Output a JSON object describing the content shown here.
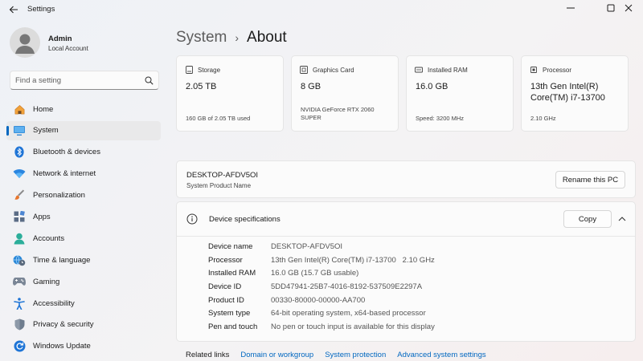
{
  "window": {
    "title": "Settings"
  },
  "user": {
    "name": "Admin",
    "account_type": "Local Account"
  },
  "search": {
    "placeholder": "Find a setting"
  },
  "sidebar": {
    "items": [
      {
        "label": "Home",
        "icon": "home-icon"
      },
      {
        "label": "System",
        "icon": "system-icon",
        "active": true
      },
      {
        "label": "Bluetooth & devices",
        "icon": "bluetooth-icon"
      },
      {
        "label": "Network & internet",
        "icon": "wifi-icon"
      },
      {
        "label": "Personalization",
        "icon": "brush-icon"
      },
      {
        "label": "Apps",
        "icon": "apps-icon"
      },
      {
        "label": "Accounts",
        "icon": "accounts-icon"
      },
      {
        "label": "Time & language",
        "icon": "globe-clock-icon"
      },
      {
        "label": "Gaming",
        "icon": "gamepad-icon"
      },
      {
        "label": "Accessibility",
        "icon": "accessibility-icon"
      },
      {
        "label": "Privacy & security",
        "icon": "shield-icon"
      },
      {
        "label": "Windows Update",
        "icon": "update-icon"
      }
    ]
  },
  "breadcrumb": {
    "parent": "System",
    "separator": "›",
    "current": "About"
  },
  "cards": {
    "storage": {
      "title": "Storage",
      "value": "2.05 TB",
      "sub": "160 GB of 2.05 TB used"
    },
    "graphics": {
      "title": "Graphics Card",
      "value": "8 GB",
      "sub": "NVIDIA GeForce RTX 2060 SUPER"
    },
    "ram": {
      "title": "Installed RAM",
      "value": "16.0 GB",
      "sub": "Speed: 3200 MHz"
    },
    "processor": {
      "title": "Processor",
      "value": "13th Gen Intel(R) Core(TM) i7-13700",
      "sub": "2.10 GHz"
    }
  },
  "pc": {
    "name": "DESKTOP-AFDV5OI",
    "description": "System Product Name",
    "rename_label": "Rename this PC"
  },
  "specs": {
    "title": "Device specifications",
    "copy_label": "Copy",
    "rows": [
      {
        "label": "Device name",
        "value": "DESKTOP-AFDV5OI"
      },
      {
        "label": "Processor",
        "value": "13th Gen Intel(R) Core(TM) i7-13700   2.10 GHz"
      },
      {
        "label": "Installed RAM",
        "value": "16.0 GB (15.7 GB usable)"
      },
      {
        "label": "Device ID",
        "value": "5DD47941-25B7-4016-8192-537509E2297A"
      },
      {
        "label": "Product ID",
        "value": "00330-80000-00000-AA700"
      },
      {
        "label": "System type",
        "value": "64-bit operating system, x64-based processor"
      },
      {
        "label": "Pen and touch",
        "value": "No pen or touch input is available for this display"
      }
    ]
  },
  "related": {
    "label": "Related links",
    "links": [
      "Domain or workgroup",
      "System protection",
      "Advanced system settings"
    ]
  },
  "colors": {
    "accent": "#0067c0"
  }
}
